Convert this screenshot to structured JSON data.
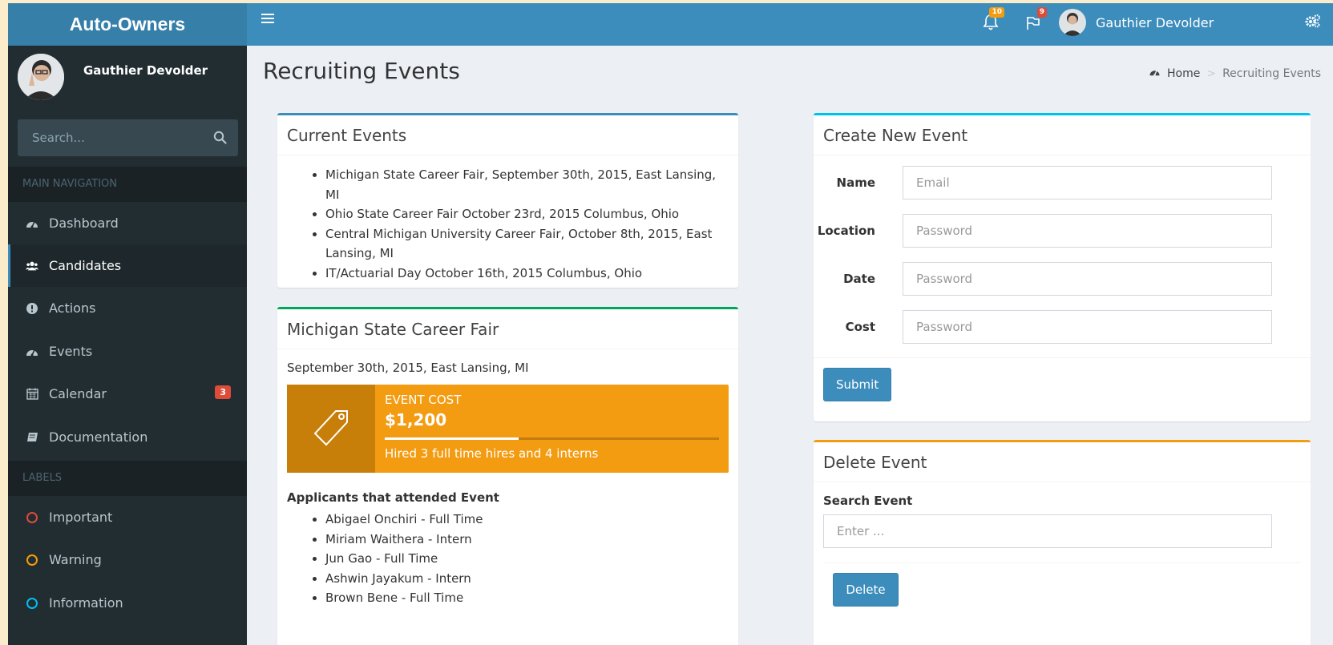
{
  "app": {
    "logo": "Auto-Owners"
  },
  "topbar": {
    "notifications_count": "10",
    "flags_count": "9",
    "user_name": "Gauthier Devolder"
  },
  "sidebar": {
    "user_name": "Gauthier Devolder",
    "search_placeholder": "Search...",
    "main_nav_header": "MAIN NAVIGATION",
    "items": [
      {
        "label": "Dashboard",
        "icon": "dashboard-icon"
      },
      {
        "label": "Candidates",
        "icon": "users-icon"
      },
      {
        "label": "Actions",
        "icon": "exclamation-icon"
      },
      {
        "label": "Events",
        "icon": "dashboard-icon"
      },
      {
        "label": "Calendar",
        "icon": "calendar-icon",
        "badge": "3"
      },
      {
        "label": "Documentation",
        "icon": "book-icon"
      }
    ],
    "labels_header": "LABELS",
    "labels": [
      {
        "label": "Important",
        "color": "#dd4b39"
      },
      {
        "label": "Warning",
        "color": "#f39c12"
      },
      {
        "label": "Information",
        "color": "#00c0ef"
      }
    ]
  },
  "page": {
    "title": "Recruiting Events",
    "breadcrumb": {
      "home": "Home",
      "current": "Recruiting Events"
    }
  },
  "current_events": {
    "title": "Current Events",
    "items": [
      "Michigan State Career Fair, September 30th, 2015, East Lansing, MI",
      "Ohio State Career Fair October 23rd, 2015 Columbus, Ohio",
      "Central Michigan University Career Fair, October 8th, 2015, East Lansing, MI",
      "IT/Actuarial Day October 16th, 2015 Columbus, Ohio"
    ]
  },
  "event_detail": {
    "title": "Michigan State Career Fair",
    "subtitle": "September 30th, 2015, East Lansing, MI",
    "cost_label": "EVENT COST",
    "cost_value": "$1,200",
    "progress_fraction": 0.4,
    "progress_desc": "Hired 3 full time hires and 4 interns",
    "applicants_header": "Applicants that attended Event",
    "applicants": [
      "Abigael Onchiri - Full Time",
      "Miriam Waithera - Intern",
      "Jun Gao - Full Time",
      "Ashwin Jayakum - Intern",
      "Brown Bene - Full Time"
    ]
  },
  "create_event": {
    "title": "Create New Event",
    "fields": [
      {
        "label": "Name",
        "placeholder": "Email"
      },
      {
        "label": "Location",
        "placeholder": "Password"
      },
      {
        "label": "Date",
        "placeholder": "Password"
      },
      {
        "label": "Cost",
        "placeholder": "Password"
      }
    ],
    "submit_label": "Submit"
  },
  "delete_event": {
    "title": "Delete Event",
    "search_label": "Search Event",
    "search_placeholder": "Enter ...",
    "delete_label": "Delete"
  }
}
